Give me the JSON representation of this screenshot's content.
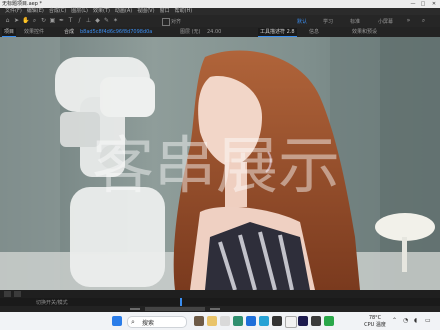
{
  "window": {
    "title": "无标题项目.aep *",
    "controls": {
      "minimize": "—",
      "maximize": "□",
      "close": "✕"
    }
  },
  "menu": [
    "文件(F)",
    "编辑(E)",
    "合成(C)",
    "图层(L)",
    "效果(T)",
    "动画(A)",
    "视图(V)",
    "窗口",
    "帮助(H)"
  ],
  "toolbar": {
    "workspaces": [
      {
        "label": "默认",
        "active": true
      },
      {
        "label": "学习",
        "active": false
      },
      {
        "label": "标准",
        "active": false
      },
      {
        "label": "小屏幕",
        "active": false
      }
    ],
    "snap_label": "对齐"
  },
  "panel_tabs": {
    "left": [
      {
        "label": "项目",
        "active": true
      },
      {
        "label": "效果控件",
        "active": false
      }
    ],
    "comp_tab": {
      "label": "合成",
      "subtitle": "b8ad5c8f4d6c96f8d7098d0a"
    },
    "right": [
      {
        "label": "图层 (无)",
        "active": false
      },
      {
        "label": "工具描述符 2.8",
        "active": true
      },
      {
        "label": "信息",
        "active": false
      },
      {
        "label": "效果和预设",
        "active": false
      }
    ],
    "fps": "24.00"
  },
  "viewer": {
    "watermark": "客串展示"
  },
  "timeline": {
    "label": "切换开关/模式"
  },
  "taskbar": {
    "search_placeholder": "搜索",
    "weather_temp": "78°C",
    "weather_label": "CPU 温度"
  }
}
